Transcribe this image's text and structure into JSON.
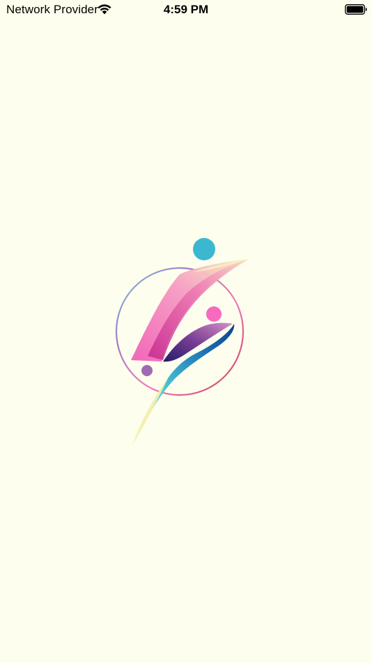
{
  "status_bar": {
    "carrier": "Network Provider",
    "time": "4:59 PM",
    "wifi_icon": "wifi-icon",
    "battery_icon": "battery-full-icon"
  },
  "splash": {
    "logo_icon": "abstract-figure-logo-icon",
    "background_color": "#fdfeed",
    "accent_colors": [
      "#3bb7d0",
      "#f66ac0",
      "#2a3d8f",
      "#a06ab2",
      "#f8eeb8"
    ]
  }
}
